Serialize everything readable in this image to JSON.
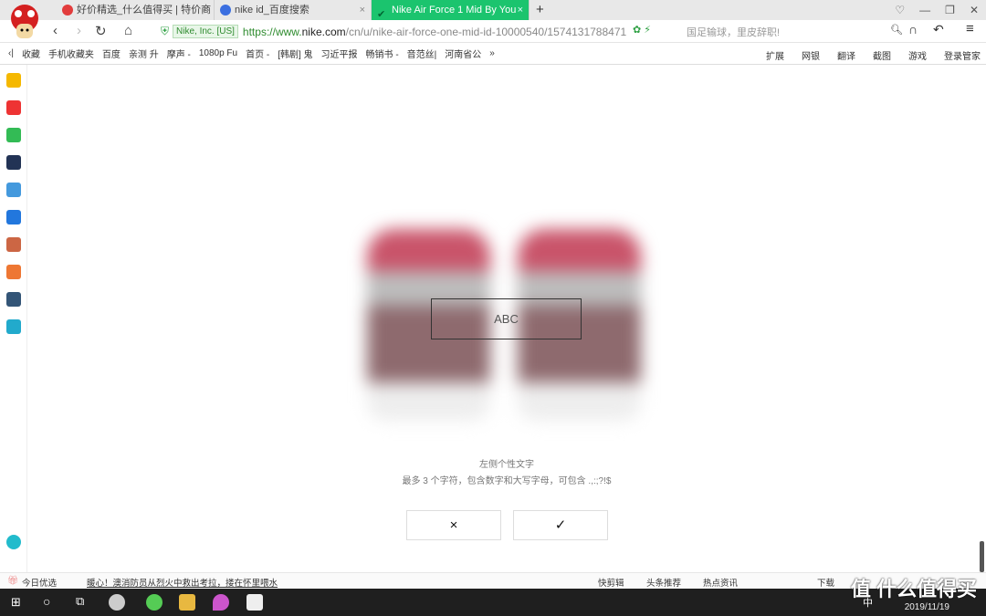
{
  "tabs": [
    {
      "label": "好价精选_什么值得买 | 特价商品",
      "icon_color": "#e23c3c"
    },
    {
      "label": "nike id_百度搜索",
      "icon_color": "#3b6fe0"
    },
    {
      "label": "Nike Air Force 1 Mid By You",
      "icon_color": "#0a6"
    }
  ],
  "address": {
    "cert": "Nike, Inc. [US]",
    "scheme": "https://www.",
    "domain": "nike.com",
    "path": "/cn/u/nike-air-force-one-mid-id-10000540/1574131788471",
    "search_hint": "国足输球，里皮辞职!"
  },
  "bookmarks": [
    "收藏",
    "手机收藏夹",
    "百度",
    "亲测 升",
    "摩声 -",
    "1080p Fu",
    "首页 -",
    "[韩剧] 鬼",
    "习近平报",
    "畅销书 -",
    "音范丝|",
    "河南省公",
    "»"
  ],
  "bookmarks_right": [
    "扩展",
    "网银",
    "翻译",
    "截图",
    "游戏",
    "登录管家"
  ],
  "editor": {
    "input_value": "ABC",
    "label": "左侧个性文字",
    "hint": "最多 3 个字符，包含数字和大写字母，可包含 .,:;?!$",
    "cancel_icon": "×",
    "confirm_icon": "✓"
  },
  "status": {
    "left": "今日优选",
    "news": "暖心！澳消防员从烈火中救出考拉，搂在怀里喂水",
    "items": [
      "快剪辑",
      "头条推荐",
      "热点资讯",
      "下载"
    ]
  },
  "taskbar": {
    "date": "2019/11/19",
    "ime": "中"
  },
  "watermark": "值 什么值得买"
}
